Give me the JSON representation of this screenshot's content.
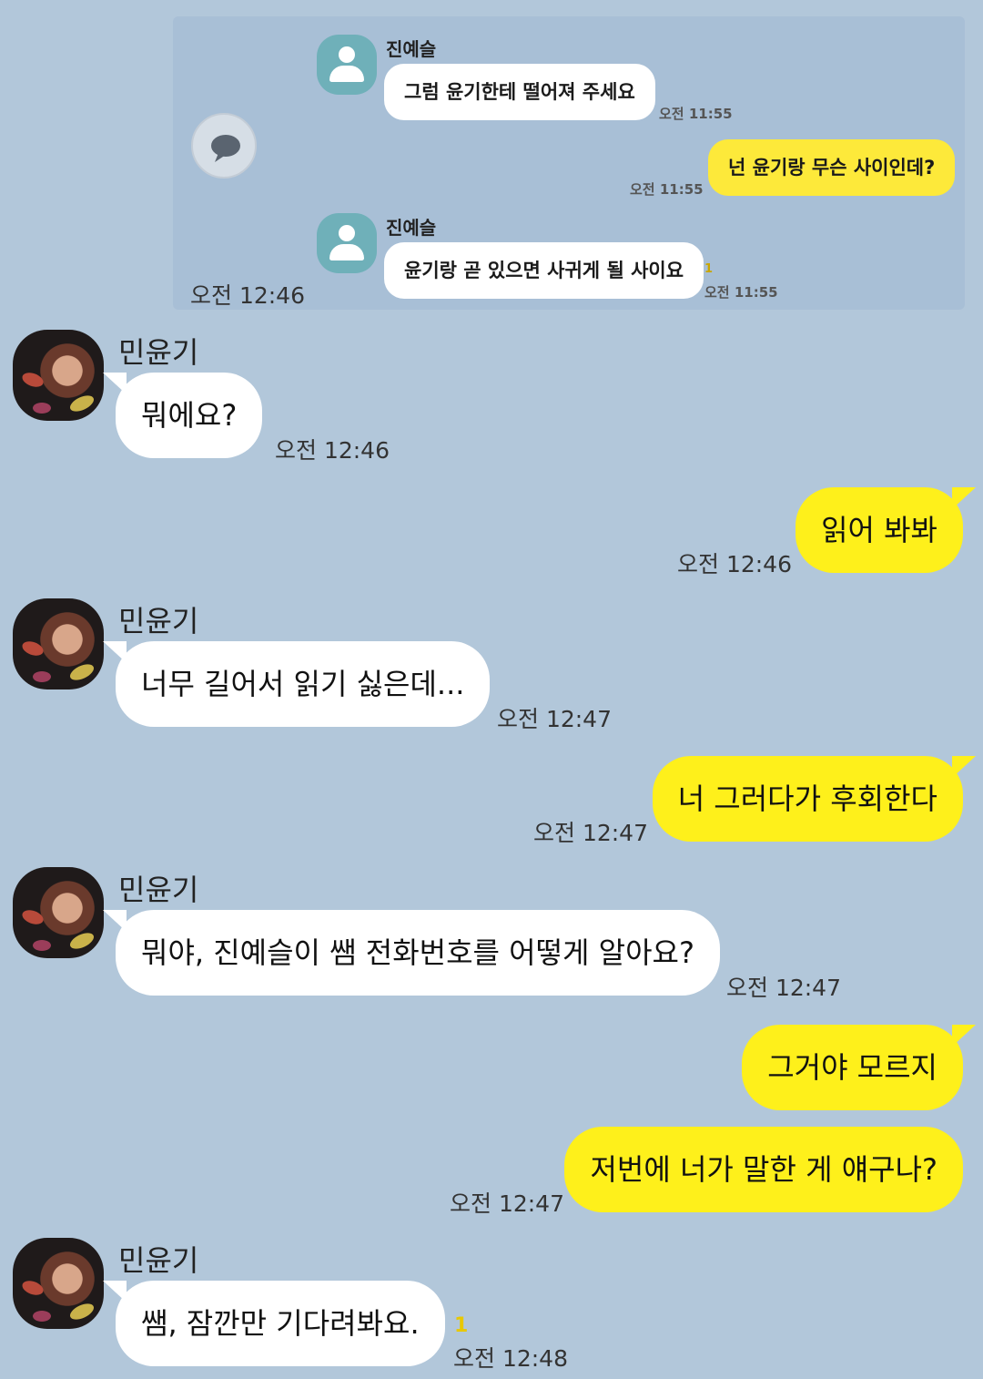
{
  "embedded": {
    "msg1": {
      "sender": "진예슬",
      "text": "그럼 윤기한테 떨어져 주세요",
      "time": "오전 11:55"
    },
    "msg2": {
      "text": "넌 윤기랑 무슨 사이인데?",
      "time": "오전 11:55"
    },
    "msg3": {
      "sender": "진예슬",
      "text": "윤기랑 곧 있으면 사귀게 될 사이요",
      "time": "오전 11:55",
      "unread": "1"
    },
    "share_time": "오전 12:46"
  },
  "messages": [
    {
      "side": "left",
      "sender": "민윤기",
      "text": "뭐에요?",
      "time": "오전 12:46"
    },
    {
      "side": "right",
      "text": "읽어 봐봐",
      "time": "오전 12:46"
    },
    {
      "side": "left",
      "sender": "민윤기",
      "text": "너무 길어서 읽기 싫은데...",
      "time": "오전 12:47"
    },
    {
      "side": "right",
      "text": "너 그러다가 후회한다",
      "time": "오전 12:47"
    },
    {
      "side": "left",
      "sender": "민윤기",
      "text": "뭐야, 진예슬이 쌤 전화번호를 어떻게 알아요?",
      "time": "오전 12:47"
    },
    {
      "side": "right",
      "text": "그거야 모르지",
      "time": ""
    },
    {
      "side": "right",
      "text": "저번에 너가 말한 게 얘구나?",
      "time": "오전 12:47"
    },
    {
      "side": "left",
      "sender": "민윤기",
      "text": "쌤, 잠깐만 기다려봐요.",
      "time": "오전 12:48",
      "unread": "1"
    }
  ],
  "colors": {
    "background": "#b2c7da",
    "my_bubble": "#fef01b",
    "their_bubble": "#ffffff"
  },
  "icons": {
    "share": "speech-bubble-icon",
    "profile": "default-profile-icon"
  }
}
